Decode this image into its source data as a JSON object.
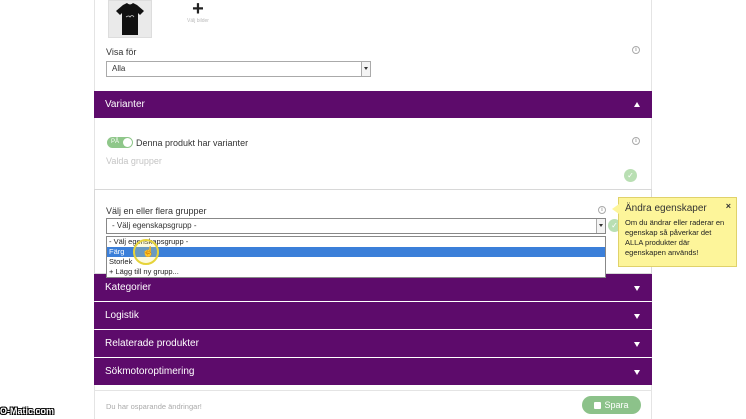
{
  "images": {
    "add_label": "Välj bilder"
  },
  "visa_for": {
    "label": "Visa för",
    "value": "Alla"
  },
  "variants_section": {
    "title": "Varianter"
  },
  "variants": {
    "toggle_state": "PÅ",
    "toggle_label": "Denna produkt har varianter",
    "selected_groups_label": "Valda grupper"
  },
  "group_selector": {
    "label": "Välj en eller flera grupper",
    "value": "- Välj egenskapsgrupp -",
    "options": [
      "- Välj egenskapsgrupp -",
      "Färg",
      "Storlek",
      "+ Lägg till ny grupp..."
    ],
    "highlighted_index": 1
  },
  "tooltip": {
    "title": "Ändra egenskaper",
    "body": "Om du ändrar eller raderar en egenskap så påverkar det ALLA produkter där egenskapen används!",
    "close": "×"
  },
  "sections": [
    {
      "title": "Kategorier"
    },
    {
      "title": "Logistik"
    },
    {
      "title": "Relaterade produkter"
    },
    {
      "title": "Sökmotoroptimering"
    }
  ],
  "footer": {
    "unsaved_text": "Du har osparande ändringar!",
    "save_label": "Spara"
  },
  "watermark": "O-Matic.com",
  "colors": {
    "section_bg": "#5d0b6b",
    "toggle_on": "#8fc78a",
    "highlight": "#3b7fd9",
    "tooltip_bg": "#fdf59a",
    "save_bg": "#8cc28a"
  }
}
